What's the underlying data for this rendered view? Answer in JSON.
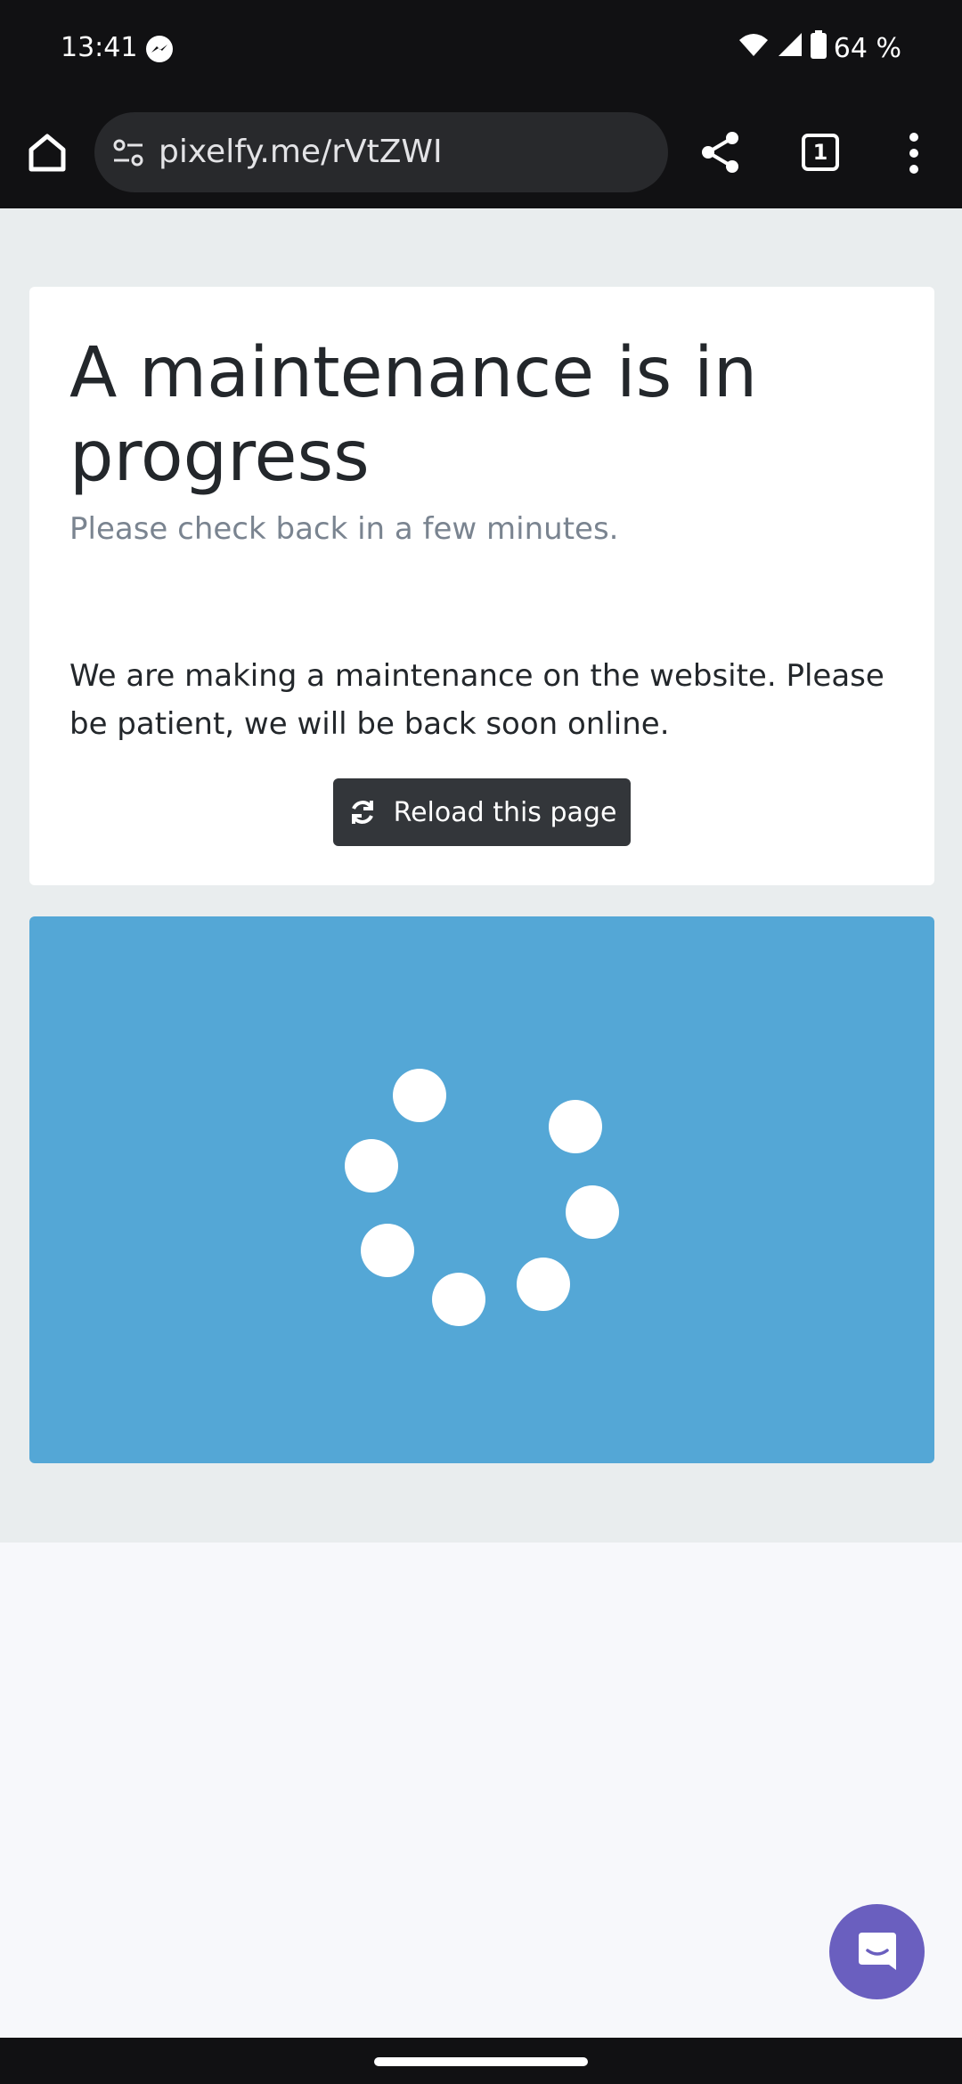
{
  "status_bar": {
    "time": "13:41",
    "battery": "64 %",
    "icons": [
      "messenger-icon",
      "wifi-icon",
      "cellular-signal-icon",
      "battery-icon"
    ]
  },
  "browser": {
    "url": "pixelfy.me/rVtZWI",
    "tab_count": "1",
    "icons": [
      "home-icon",
      "site-settings-icon",
      "share-icon",
      "tabs-icon",
      "more-vert-icon"
    ]
  },
  "page": {
    "title": "A maintenance is in progress",
    "subtitle": "Please check back in a few minutes.",
    "body": "We are making a maintenance on the website. Please be patient, we will be back soon online.",
    "reload_button": "Reload this page"
  },
  "colors": {
    "loader_panel": "#54a7d6",
    "button_dark": "#33363a",
    "chat_button": "#6a5fbf",
    "page_background": "#e9edee"
  },
  "chat_widget": {
    "icon": "chat-bubble-icon"
  }
}
